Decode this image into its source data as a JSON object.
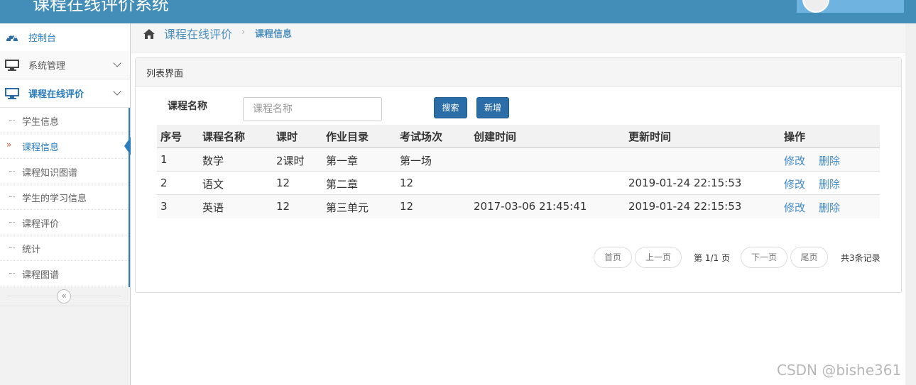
{
  "app": {
    "title": "课程在线评价系统"
  },
  "sidebar": {
    "items": [
      {
        "label": "控制台",
        "icon": "dashboard-icon"
      },
      {
        "label": "系统管理",
        "icon": "desktop-icon"
      },
      {
        "label": "课程在线评价",
        "icon": "desktop-icon"
      }
    ],
    "submenu": [
      {
        "label": "学生信息"
      },
      {
        "label": "课程信息"
      },
      {
        "label": "课程知识图谱"
      },
      {
        "label": "学生的学习信息"
      },
      {
        "label": "课程评价"
      },
      {
        "label": "统计"
      },
      {
        "label": "课程图谱"
      }
    ],
    "collapse_glyph": "«"
  },
  "breadcrumb": {
    "main": "课程在线评价",
    "sep": "›",
    "sub": "课程信息"
  },
  "panel": {
    "title": "列表界面"
  },
  "search": {
    "label": "课程名称",
    "placeholder": "课程名称",
    "search_label": "搜索",
    "add_label": "新增"
  },
  "table": {
    "headers": [
      "序号",
      "课程名称",
      "课时",
      "作业目录",
      "考试场次",
      "创建时间",
      "更新时间",
      "操作"
    ],
    "rows": [
      [
        "1",
        "数学",
        "2课时",
        "第一章",
        "第一场",
        "",
        ""
      ],
      [
        "2",
        "语文",
        "12",
        "第二章",
        "12",
        "",
        "2019-01-24 22:15:53"
      ],
      [
        "3",
        "英语",
        "12",
        "第三单元",
        "12",
        "2017-03-06 21:45:41",
        "2019-01-24 22:15:53"
      ]
    ],
    "edit_label": "修改",
    "delete_label": "删除"
  },
  "pagination": {
    "first": "首页",
    "prev": "上一页",
    "current": "第 1/1 页",
    "next": "下一页",
    "last": "尾页",
    "total": "共3条记录"
  },
  "watermark": "CSDN @bishe361",
  "colors": {
    "navbar": "#438eb9",
    "accent": "#2b7dbc",
    "button": "#2b6da7",
    "link": "#428bca"
  }
}
